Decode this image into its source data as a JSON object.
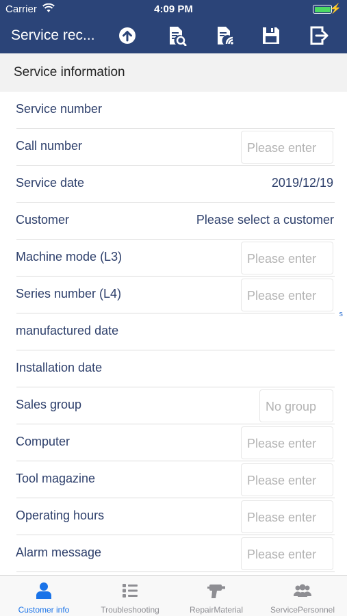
{
  "status_bar": {
    "carrier": "Carrier",
    "time": "4:09 PM",
    "battery_level": 1.0
  },
  "nav": {
    "title": "Service rec...",
    "icons": [
      "upload-icon",
      "document-search-icon",
      "document-signal-icon",
      "save-icon",
      "exit-icon"
    ]
  },
  "section": {
    "title": "Service information"
  },
  "rows": [
    {
      "label": "Service number",
      "value": "",
      "placeholder": ""
    },
    {
      "label": "Call number",
      "value": "",
      "placeholder": "Please enter"
    },
    {
      "label": "Service date",
      "value": "2019/12/19",
      "placeholder": ""
    },
    {
      "label": "Customer",
      "value": "Please select a customer",
      "placeholder": ""
    },
    {
      "label": "Machine mode (L3)",
      "value": "",
      "placeholder": "Please enter"
    },
    {
      "label": "Series number (L4)",
      "value": "",
      "placeholder": "Please enter"
    },
    {
      "label": "manufactured date",
      "value": "",
      "placeholder": ""
    },
    {
      "label": "Installation date",
      "value": "",
      "placeholder": ""
    },
    {
      "label": "Sales group",
      "value": "",
      "placeholder": "No group"
    },
    {
      "label": "Computer",
      "value": "",
      "placeholder": "Please enter"
    },
    {
      "label": "Tool magazine",
      "value": "",
      "placeholder": "Please enter"
    },
    {
      "label": "Operating hours",
      "value": "",
      "placeholder": "Please enter"
    },
    {
      "label": "Alarm message",
      "value": "",
      "placeholder": "Please enter"
    }
  ],
  "side_marker": "s",
  "tabs": [
    {
      "label": "Customer info",
      "icon": "person-icon",
      "active": true
    },
    {
      "label": "Troubleshooting",
      "icon": "list-icon",
      "active": false
    },
    {
      "label": "RepairMaterial",
      "icon": "drill-icon",
      "active": false
    },
    {
      "label": "ServicePersonnel",
      "icon": "group-icon",
      "active": false
    }
  ],
  "colors": {
    "nav_bg": "#2b4478",
    "label": "#2d3f6b",
    "placeholder": "#b3b3b3",
    "tab_active": "#1a73e8",
    "tab_inactive": "#8e8e93",
    "battery": "#4cd964"
  }
}
